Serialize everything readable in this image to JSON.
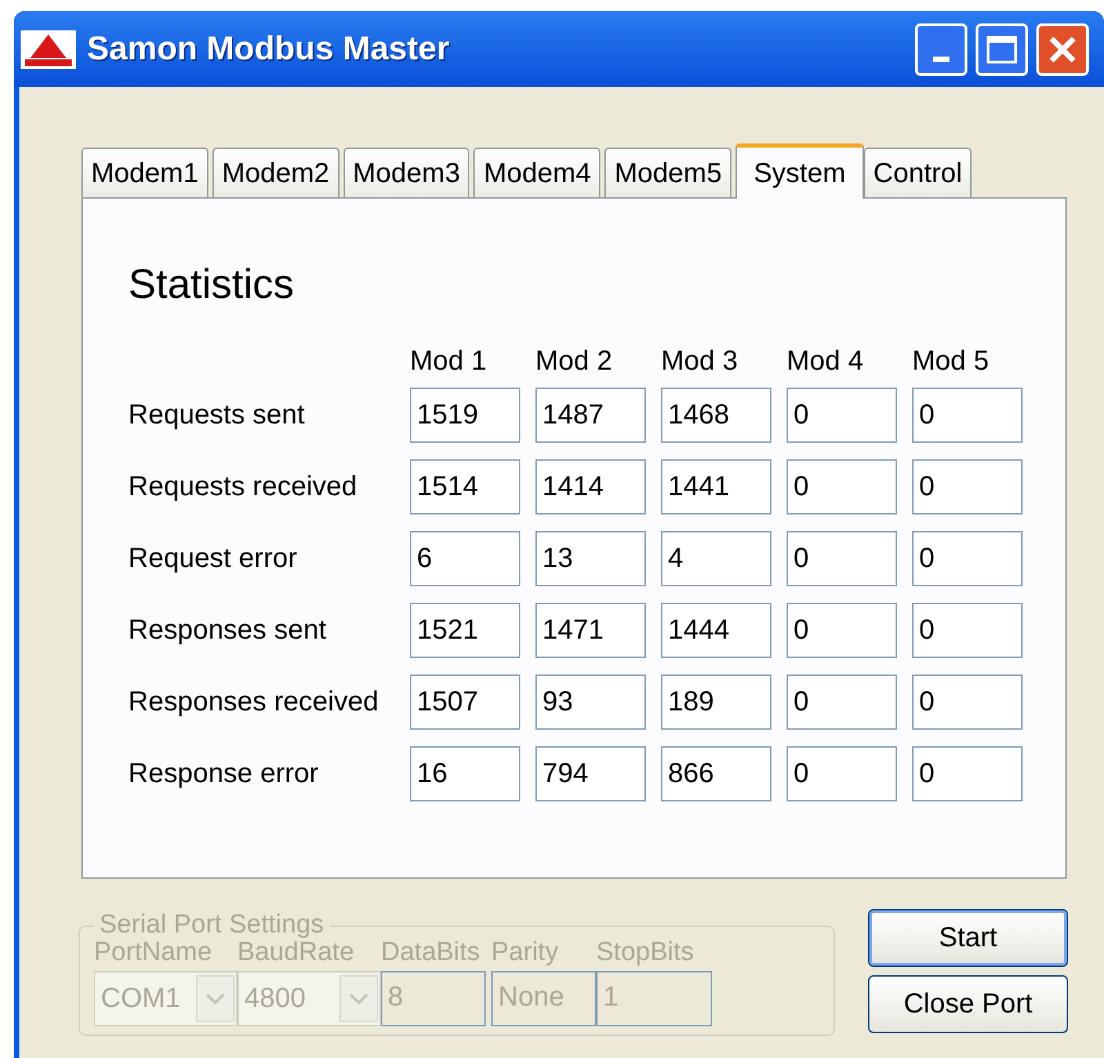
{
  "window": {
    "title": "Samon Modbus Master"
  },
  "tabs": [
    {
      "label": "Modem1",
      "selected": false
    },
    {
      "label": "Modem2",
      "selected": false
    },
    {
      "label": "Modem3",
      "selected": false
    },
    {
      "label": "Modem4",
      "selected": false
    },
    {
      "label": "Modem5",
      "selected": false
    },
    {
      "label": "System",
      "selected": true
    },
    {
      "label": "Control",
      "selected": false
    }
  ],
  "statistics": {
    "title": "Statistics",
    "columns": [
      "Mod 1",
      "Mod 2",
      "Mod 3",
      "Mod 4",
      "Mod 5"
    ],
    "rows": [
      {
        "label": "Requests sent",
        "values": [
          "1519",
          "1487",
          "1468",
          "0",
          "0"
        ]
      },
      {
        "label": "Requests received",
        "values": [
          "1514",
          "1414",
          "1441",
          "0",
          "0"
        ]
      },
      {
        "label": "Request error",
        "values": [
          "6",
          "13",
          "4",
          "0",
          "0"
        ]
      },
      {
        "label": "Responses sent",
        "values": [
          "1521",
          "1471",
          "1444",
          "0",
          "0"
        ]
      },
      {
        "label": "Responses received",
        "values": [
          "1507",
          "93",
          "189",
          "0",
          "0"
        ]
      },
      {
        "label": "Response error",
        "values": [
          "16",
          "794",
          "866",
          "0",
          "0"
        ]
      }
    ]
  },
  "serial_port_settings": {
    "title": "Serial Port Settings",
    "disabled": true,
    "fields": [
      {
        "kind": "dropdown",
        "label": "PortName",
        "value": "COM1"
      },
      {
        "kind": "dropdown",
        "label": "BaudRate",
        "value": "4800"
      },
      {
        "kind": "text",
        "label": "DataBits",
        "value": "8"
      },
      {
        "kind": "text",
        "label": "Parity",
        "value": "None"
      },
      {
        "kind": "text",
        "label": "StopBits",
        "value": "1"
      }
    ]
  },
  "buttons": [
    {
      "label": "Start",
      "selected": true
    },
    {
      "label": "Close Port",
      "selected": false
    }
  ]
}
